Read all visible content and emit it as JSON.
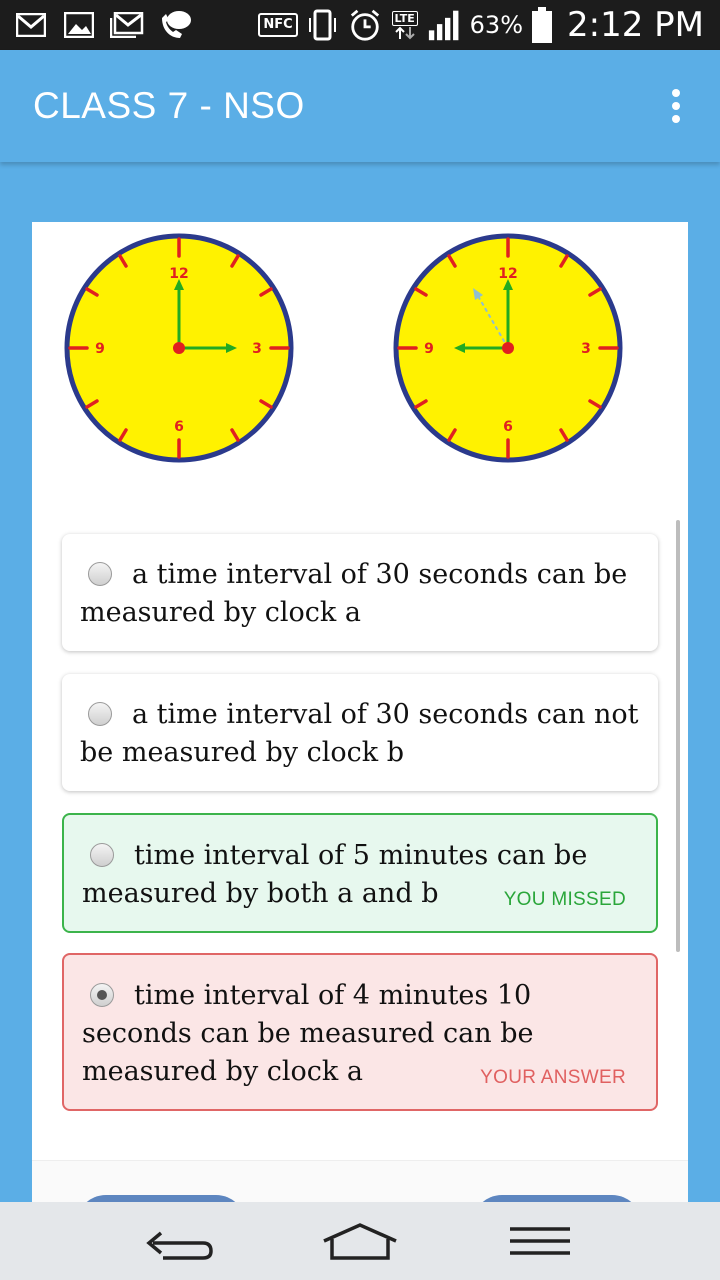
{
  "status_bar": {
    "nfc_label": "NFC",
    "lte_label": "LTE",
    "battery_percent": "63%",
    "time": "2:12 PM",
    "left_icons": [
      "gmail-icon",
      "gallery-icon",
      "gmail-icon",
      "hangouts-icon"
    ],
    "right_icons": [
      "nfc-icon",
      "vibrate-icon",
      "alarm-icon",
      "lte-icon",
      "signal-icon",
      "battery-icon"
    ]
  },
  "app_bar": {
    "title": "CLASS 7 - NSO",
    "menu_icon": "overflow-menu-icon"
  },
  "question": {
    "figure": {
      "clocks": [
        {
          "numbers": [
            "12",
            "3",
            "6",
            "9"
          ],
          "hands": "hour hand at 3, minute hand at 12"
        },
        {
          "numbers": [
            "12",
            "3",
            "6",
            "9"
          ],
          "hands": "hands at 12 and 9, dashed hand near 11"
        }
      ]
    },
    "options": [
      {
        "text": "a time interval of 30 seconds can be measured by clock a",
        "state": "none",
        "selected": false
      },
      {
        "text": "a time interval of 30 seconds can not be measured by clock b",
        "state": "none",
        "selected": false
      },
      {
        "text": "time interval of 5 minutes can be measured by both a and b",
        "state": "missed",
        "selected": false,
        "tag": "YOU MISSED"
      },
      {
        "text": "time interval of 4 minutes 10 seconds can be measured can be measured by clock a",
        "state": "wrong",
        "selected": true,
        "tag": "YOUR ANSWER"
      }
    ]
  },
  "colors": {
    "app_bar": "#5baee6",
    "clock_face": "#fff200",
    "clock_rim": "#2b3a8c",
    "missed_border": "#3cb44b",
    "wrong_border": "#e06666"
  },
  "nav_bar": {
    "icons": [
      "back-icon",
      "home-icon",
      "menu-icon"
    ]
  }
}
